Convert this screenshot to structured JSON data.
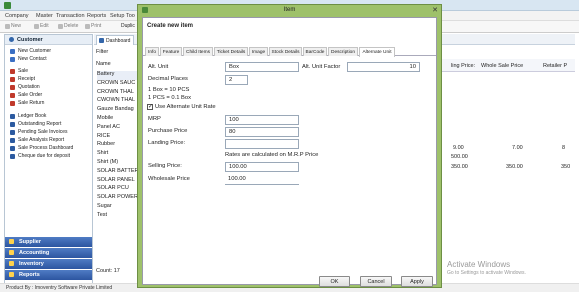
{
  "app": {
    "title": "",
    "menu": [
      "Company",
      "Master",
      "Transaction",
      "Reports",
      "Setup",
      "Too"
    ],
    "toolbar": {
      "new": "New",
      "edit": "Edit",
      "delete": "Delete",
      "print": "Print",
      "duplicate": "Duplic"
    }
  },
  "sidebar": {
    "header": "Customer",
    "items": [
      {
        "label": "New Customer",
        "icon": "customer-icon",
        "color": "#3a6fc4"
      },
      {
        "label": "New Contact",
        "icon": "contact-icon",
        "color": "#3a6fc4"
      },
      {
        "label": "Sale",
        "icon": "sale-icon",
        "color": "#c0392b"
      },
      {
        "label": "Receipt",
        "icon": "receipt-icon",
        "color": "#c0392b"
      },
      {
        "label": "Quotation",
        "icon": "quotation-icon",
        "color": "#c0392b"
      },
      {
        "label": "Sale Order",
        "icon": "sale-order-icon",
        "color": "#c0392b"
      },
      {
        "label": "Sale Return",
        "icon": "sale-return-icon",
        "color": "#c0392b"
      },
      {
        "label": "Ledger Book",
        "icon": "ledger-icon",
        "color": "#2c5aa0"
      },
      {
        "label": "Outstanding Report",
        "icon": "report-icon",
        "color": "#2c5aa0"
      },
      {
        "label": "Pending Sale Invoices",
        "icon": "report-icon",
        "color": "#2c5aa0"
      },
      {
        "label": "Sale Analysis Report",
        "icon": "report-icon",
        "color": "#2c5aa0"
      },
      {
        "label": "Sale Process Dashboard",
        "icon": "dashboard-icon",
        "color": "#2c5aa0"
      },
      {
        "label": "Cheque due for deposit",
        "icon": "cheque-icon",
        "color": "#2c5aa0"
      }
    ],
    "footer": [
      "Supplier",
      "Accounting",
      "Inventory",
      "Reports"
    ]
  },
  "tabs": {
    "dashboard": "Dashboard"
  },
  "item_list": {
    "filter_label": "Filter",
    "name_header": "Name",
    "items": [
      "Battery",
      "CROWN SAUC",
      "CROWN THAL",
      "CWOWN THAL",
      "Gauze Bandag",
      "Mobile",
      "Panel AC",
      "RICE",
      "Rubber",
      "Shirt",
      "Shirt (M)",
      "SOLAR BATTER",
      "SOLAR PANEL",
      "SOLAR PCU",
      "SOLAR POWER",
      "Sugar",
      "Test"
    ],
    "count": "Count: 17"
  },
  "grid": {
    "headers": [
      "ling Price:",
      "Whole Sale Price",
      "Retailer P"
    ],
    "rows": [
      [
        "9.00",
        "7.00",
        "8"
      ],
      [
        "500.00",
        "",
        ""
      ],
      [
        "350.00",
        "350.00",
        "350"
      ]
    ]
  },
  "dialog": {
    "title": "Item",
    "heading": "Create new item",
    "tabs": [
      "Info",
      "Feature",
      "Child Items",
      "Ticket Details",
      "Image",
      "Stock Details",
      "BarCode",
      "Description",
      "Alternate Unit"
    ],
    "active_tab": "Alternate Unit",
    "alt_unit_label": "Alt. Unit",
    "alt_unit_value": "Box",
    "alt_unit_factor_label": "Alt. Unit Factor",
    "alt_unit_factor_value": "10",
    "decimal_places_label": "Decimal Places",
    "decimal_places_value": "2",
    "conversion_1": "1 Box = 10 PCS",
    "conversion_2": "1 PCS = 0.1 Box",
    "use_alt_rate_label": "Use Alternate Unit Rate",
    "use_alt_rate_checked": "✓",
    "mrp_label": "MRP",
    "mrp_value": "100",
    "purchase_price_label": "Purchase Price",
    "purchase_price_value": "80",
    "landing_price_label": "Landing Price:",
    "landing_price_value": "",
    "rates_note": "Rates are calculated on M.R.P Price",
    "selling_price_label": "Selling Price:",
    "selling_price_value": "100.00",
    "wholesale_price_label": "Wholesale Price",
    "wholesale_price_value": "100.00",
    "buttons": {
      "ok": "OK",
      "cancel": "Cancel",
      "apply": "Apply"
    }
  },
  "status": "Product By : Imoventry Software Private Limited",
  "watermark": {
    "line1": "Activate Windows",
    "line2": "Go to Settings to activate Windows."
  }
}
